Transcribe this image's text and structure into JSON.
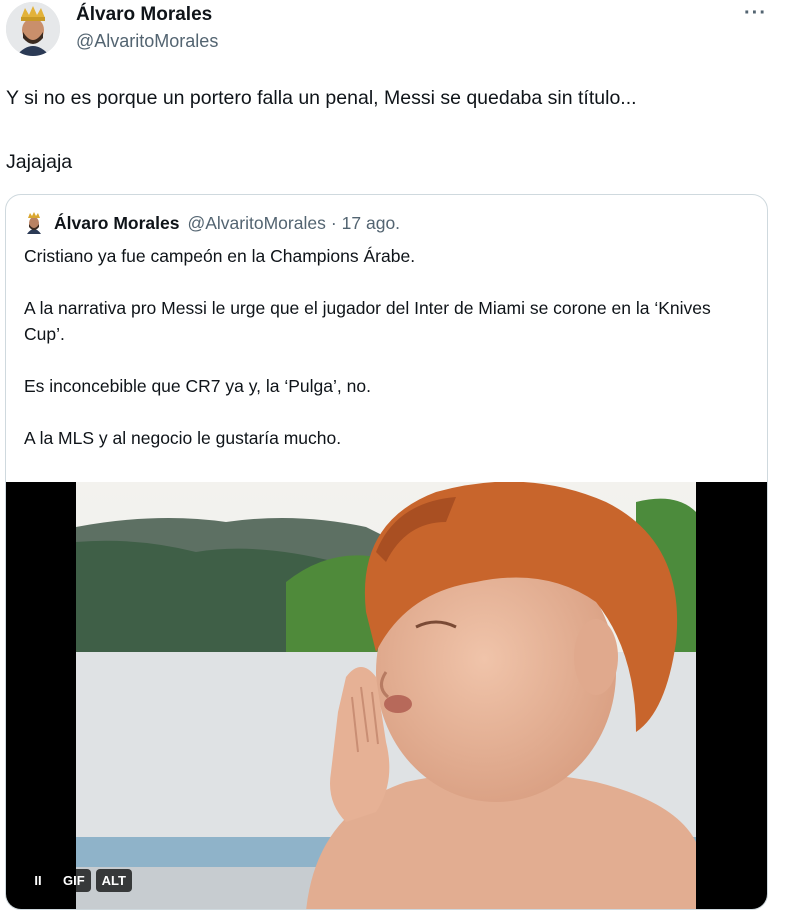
{
  "tweet": {
    "author_name": "Álvaro Morales",
    "author_handle": "@AlvaritoMorales",
    "more_label": "···",
    "text_line1": "Y si no es porque un portero falla un penal, Messi se quedaba sin título...",
    "text_line2": "Jajajaja"
  },
  "quoted_tweet": {
    "author_name": "Álvaro Morales",
    "author_handle": "@AlvaritoMorales",
    "separator": "·",
    "date": "17 ago.",
    "paragraphs": [
      "Cristiano ya fue campeón en la Champions Árabe.",
      "A la narrativa pro Messi le urge que el jugador del Inter de Miami se corone en la ‘Knives Cup’.",
      "Es inconcebible que CR7 ya y, la ‘Pulga’, no.",
      "A la MLS y al negocio le gustaría mucho."
    ],
    "media": {
      "pause_label": "II",
      "gif_label": "GIF",
      "alt_label": "ALT"
    }
  },
  "colors": {
    "text_primary": "#0f1419",
    "text_secondary": "#536471",
    "border": "#cfd9de",
    "hair": "#c8652c",
    "skin": "#e8b49a"
  }
}
